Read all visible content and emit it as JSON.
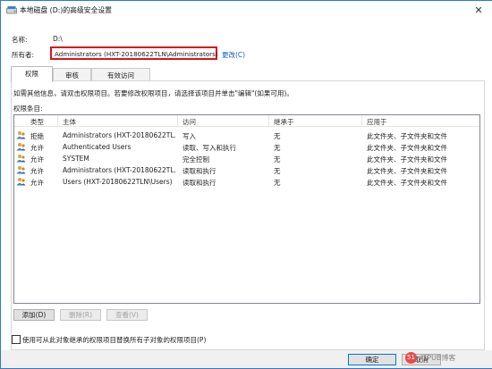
{
  "window": {
    "title": "本地磁盘 (D:)的高级安全设置",
    "close_symbol": "✕"
  },
  "info": {
    "name_label": "名称:",
    "name_value": "D:\\",
    "owner_label": "所有者:",
    "owner_value": "Administrators (HXT-20180622TLN\\Administrators)",
    "change_link": "更改(C)"
  },
  "tabs": [
    {
      "label": "权限",
      "active": true
    },
    {
      "label": "审核",
      "active": false
    },
    {
      "label": "有效访问",
      "active": false
    }
  ],
  "instructions": "如需其他信息，请双击权限项目。若要修改权限项目，请选择该项目并单击\"编辑\"(如果可用)。",
  "entries_label": "权限条目:",
  "table": {
    "columns": [
      "类型",
      "主体",
      "访问",
      "继承于",
      "应用于"
    ],
    "rows": [
      {
        "type": "拒绝",
        "principal": "Administrators (HXT-20180622TL...",
        "access": "写入",
        "inherited": "无",
        "applies": "此文件夹、子文件夹和文件"
      },
      {
        "type": "允许",
        "principal": "Authenticated Users",
        "access": "读取、写入和执行",
        "inherited": "无",
        "applies": "此文件夹、子文件夹和文件"
      },
      {
        "type": "允许",
        "principal": "SYSTEM",
        "access": "完全控制",
        "inherited": "无",
        "applies": "此文件夹、子文件夹和文件"
      },
      {
        "type": "允许",
        "principal": "Administrators (HXT-20180622TL...",
        "access": "读取和执行",
        "inherited": "无",
        "applies": "此文件夹、子文件夹和文件"
      },
      {
        "type": "允许",
        "principal": "Users (HXT-20180622TLN\\Users)",
        "access": "读取和执行",
        "inherited": "无",
        "applies": "此文件夹、子文件夹和文件"
      }
    ]
  },
  "buttons": {
    "add": "添加(D)",
    "remove": "删除(R)",
    "view": "查看(V)"
  },
  "replace_checkbox": {
    "label": "使用可从此对象继承的权限项目替换所有子对象的权限项目(P)",
    "checked": false
  },
  "footer": {
    "ok": "确定",
    "cancel": "取消"
  },
  "watermark": {
    "icon_text": "51",
    "text": "ITPUB博客"
  },
  "colors": {
    "accent": "#0078d7",
    "highlight_border": "#d9141b",
    "link": "#0b5db9"
  }
}
